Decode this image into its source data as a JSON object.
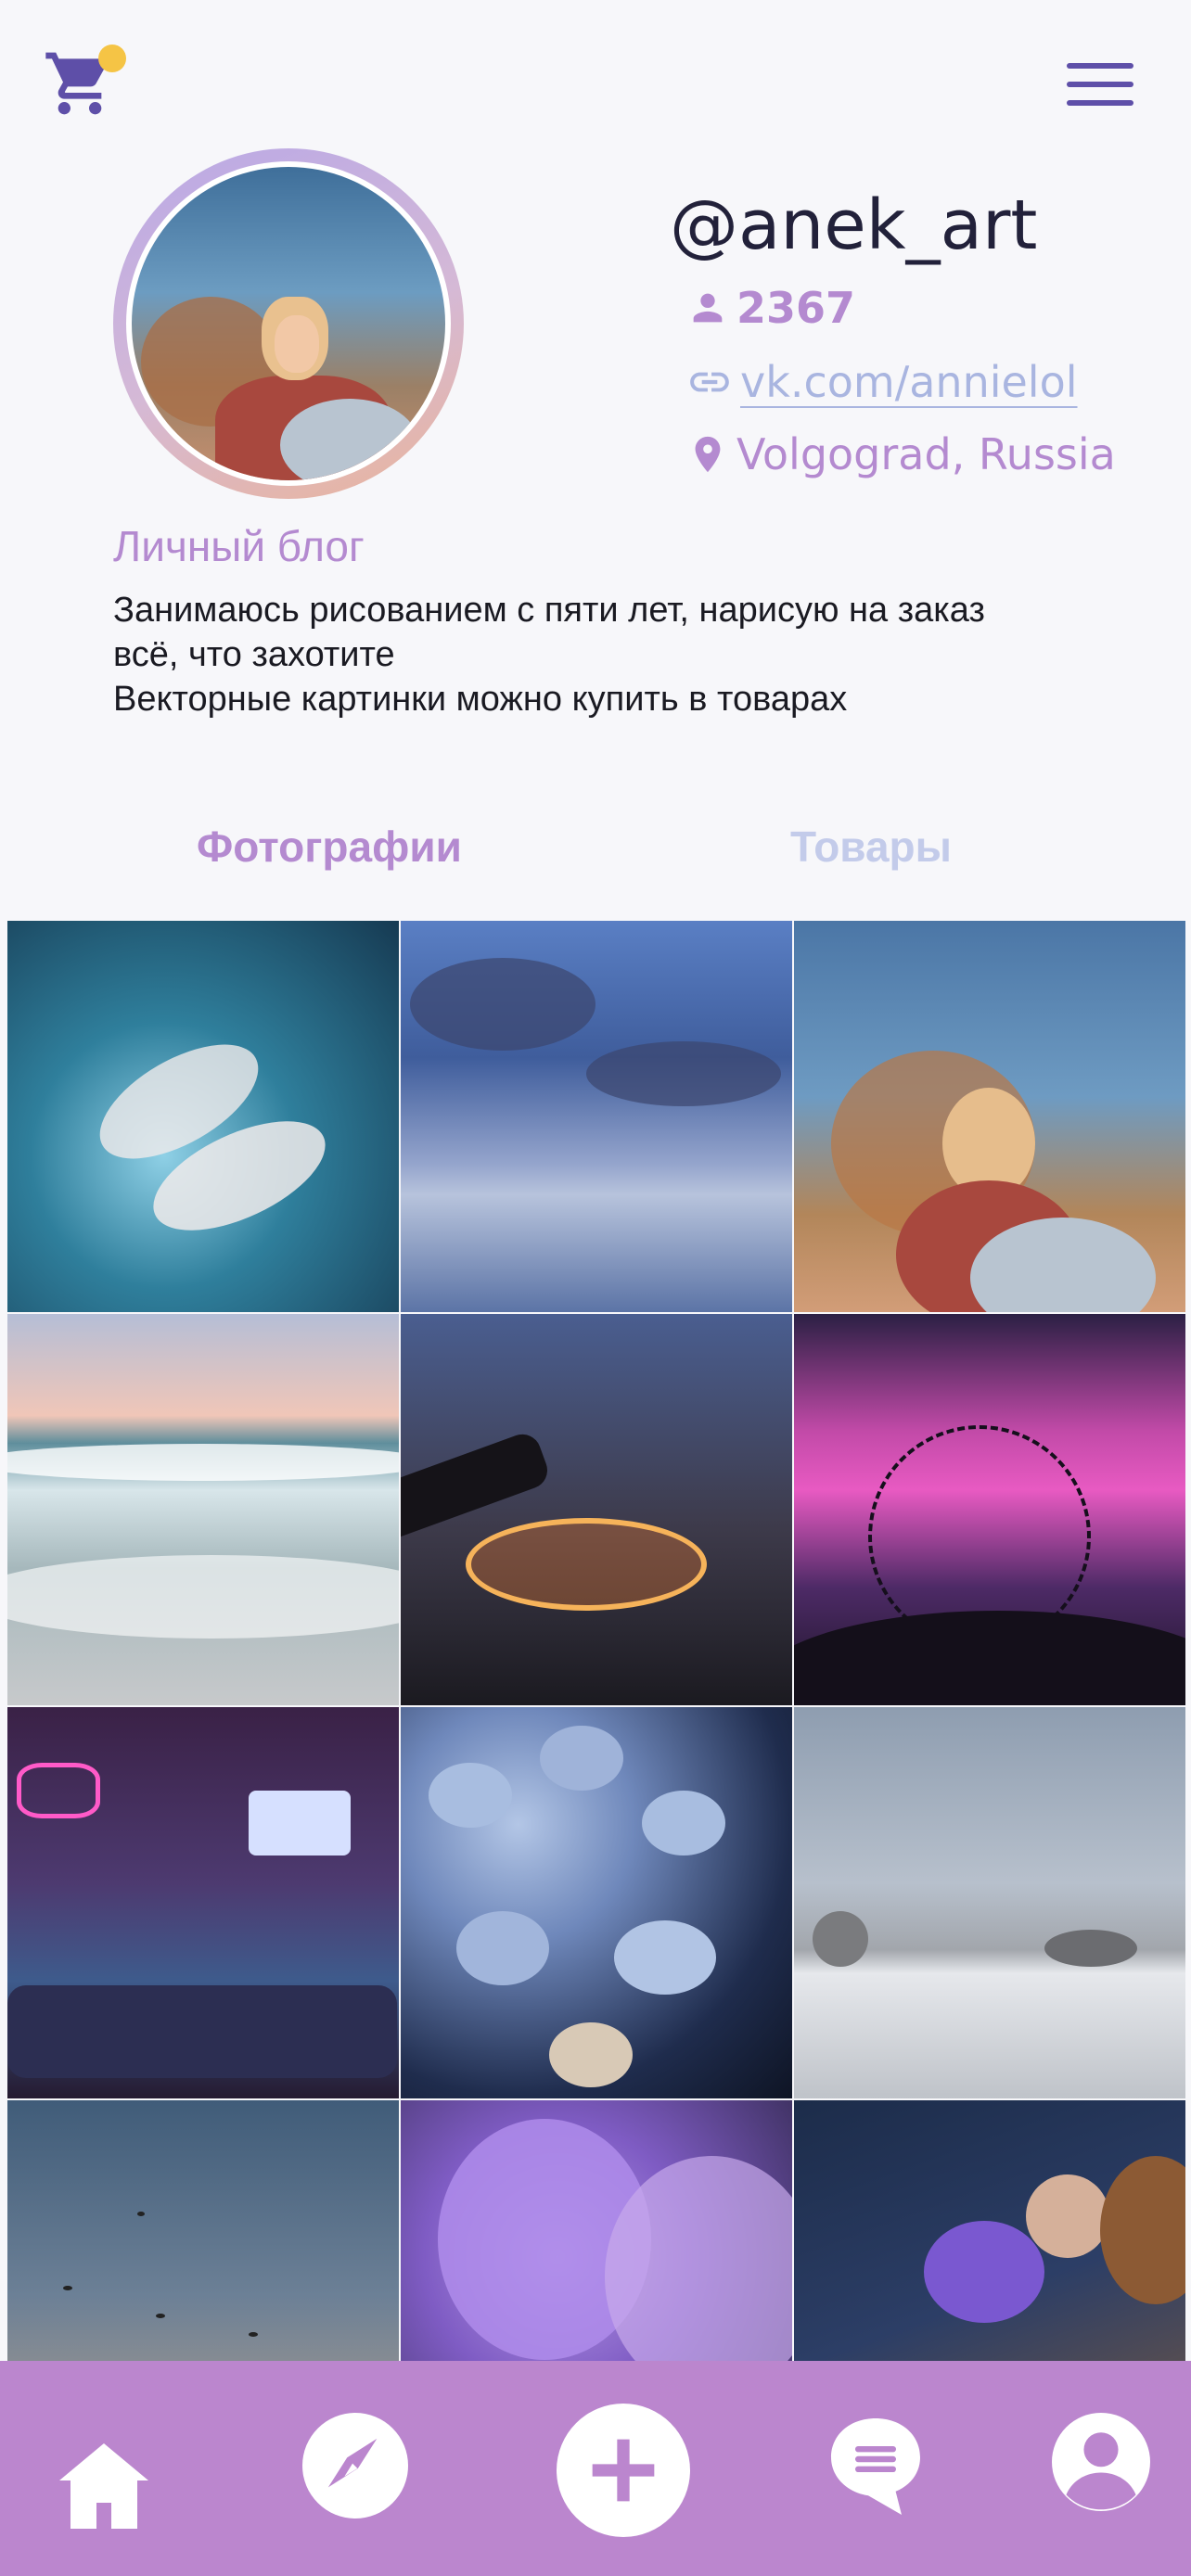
{
  "header": {
    "cart_icon": "cart-icon",
    "menu_icon": "hamburger-menu-icon",
    "accent_color": "#5e4fa8",
    "badge_color": "#f5c445"
  },
  "profile": {
    "username": "@anek_art",
    "followers": "2367",
    "link": "vk.com/annielol",
    "location": "Volgograd, Russia",
    "bio_title": "Личный блог",
    "bio_lines": [
      "Занимаюсь рисованием с пяти лет, нарисую на заказ",
      "всё, что захотите",
      "Векторные картинки можно купить в товарах"
    ]
  },
  "tabs": [
    {
      "label": "Фотографии",
      "active": true
    },
    {
      "label": "Товары",
      "active": false
    }
  ],
  "photos": [
    {
      "subject": "hands-in-water"
    },
    {
      "subject": "clouds-reflection"
    },
    {
      "subject": "girl-selfie"
    },
    {
      "subject": "sea-waves"
    },
    {
      "subject": "carousel-night"
    },
    {
      "subject": "plants-pink-sky"
    },
    {
      "subject": "neon-bar-room"
    },
    {
      "subject": "mushrooms"
    },
    {
      "subject": "winter-field"
    },
    {
      "subject": "birds-sky"
    },
    {
      "subject": "lilac-flowers"
    },
    {
      "subject": "lavender-bouquet"
    }
  ],
  "bottom_nav": {
    "background": "#bb86ce",
    "items": [
      "home-icon",
      "compass-icon",
      "add-icon",
      "chat-icon",
      "profile-icon"
    ]
  },
  "colors": {
    "accent_purple": "#b48ad0",
    "link_blue": "#a9b5e0",
    "tab_inactive": "#c3cbea"
  }
}
